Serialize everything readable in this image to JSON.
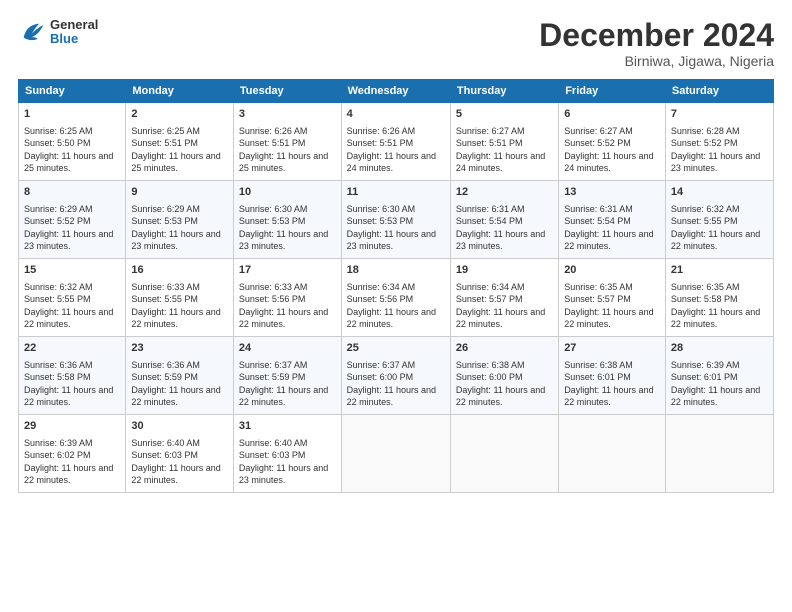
{
  "logo": {
    "general": "General",
    "blue": "Blue"
  },
  "header": {
    "title": "December 2024",
    "location": "Birniwa, Jigawa, Nigeria"
  },
  "weekdays": [
    "Sunday",
    "Monday",
    "Tuesday",
    "Wednesday",
    "Thursday",
    "Friday",
    "Saturday"
  ],
  "weeks": [
    [
      {
        "day": "1",
        "info": "Sunrise: 6:25 AM\nSunset: 5:50 PM\nDaylight: 11 hours and 25 minutes."
      },
      {
        "day": "2",
        "info": "Sunrise: 6:25 AM\nSunset: 5:51 PM\nDaylight: 11 hours and 25 minutes."
      },
      {
        "day": "3",
        "info": "Sunrise: 6:26 AM\nSunset: 5:51 PM\nDaylight: 11 hours and 25 minutes."
      },
      {
        "day": "4",
        "info": "Sunrise: 6:26 AM\nSunset: 5:51 PM\nDaylight: 11 hours and 24 minutes."
      },
      {
        "day": "5",
        "info": "Sunrise: 6:27 AM\nSunset: 5:51 PM\nDaylight: 11 hours and 24 minutes."
      },
      {
        "day": "6",
        "info": "Sunrise: 6:27 AM\nSunset: 5:52 PM\nDaylight: 11 hours and 24 minutes."
      },
      {
        "day": "7",
        "info": "Sunrise: 6:28 AM\nSunset: 5:52 PM\nDaylight: 11 hours and 23 minutes."
      }
    ],
    [
      {
        "day": "8",
        "info": "Sunrise: 6:29 AM\nSunset: 5:52 PM\nDaylight: 11 hours and 23 minutes."
      },
      {
        "day": "9",
        "info": "Sunrise: 6:29 AM\nSunset: 5:53 PM\nDaylight: 11 hours and 23 minutes."
      },
      {
        "day": "10",
        "info": "Sunrise: 6:30 AM\nSunset: 5:53 PM\nDaylight: 11 hours and 23 minutes."
      },
      {
        "day": "11",
        "info": "Sunrise: 6:30 AM\nSunset: 5:53 PM\nDaylight: 11 hours and 23 minutes."
      },
      {
        "day": "12",
        "info": "Sunrise: 6:31 AM\nSunset: 5:54 PM\nDaylight: 11 hours and 23 minutes."
      },
      {
        "day": "13",
        "info": "Sunrise: 6:31 AM\nSunset: 5:54 PM\nDaylight: 11 hours and 22 minutes."
      },
      {
        "day": "14",
        "info": "Sunrise: 6:32 AM\nSunset: 5:55 PM\nDaylight: 11 hours and 22 minutes."
      }
    ],
    [
      {
        "day": "15",
        "info": "Sunrise: 6:32 AM\nSunset: 5:55 PM\nDaylight: 11 hours and 22 minutes."
      },
      {
        "day": "16",
        "info": "Sunrise: 6:33 AM\nSunset: 5:55 PM\nDaylight: 11 hours and 22 minutes."
      },
      {
        "day": "17",
        "info": "Sunrise: 6:33 AM\nSunset: 5:56 PM\nDaylight: 11 hours and 22 minutes."
      },
      {
        "day": "18",
        "info": "Sunrise: 6:34 AM\nSunset: 5:56 PM\nDaylight: 11 hours and 22 minutes."
      },
      {
        "day": "19",
        "info": "Sunrise: 6:34 AM\nSunset: 5:57 PM\nDaylight: 11 hours and 22 minutes."
      },
      {
        "day": "20",
        "info": "Sunrise: 6:35 AM\nSunset: 5:57 PM\nDaylight: 11 hours and 22 minutes."
      },
      {
        "day": "21",
        "info": "Sunrise: 6:35 AM\nSunset: 5:58 PM\nDaylight: 11 hours and 22 minutes."
      }
    ],
    [
      {
        "day": "22",
        "info": "Sunrise: 6:36 AM\nSunset: 5:58 PM\nDaylight: 11 hours and 22 minutes."
      },
      {
        "day": "23",
        "info": "Sunrise: 6:36 AM\nSunset: 5:59 PM\nDaylight: 11 hours and 22 minutes."
      },
      {
        "day": "24",
        "info": "Sunrise: 6:37 AM\nSunset: 5:59 PM\nDaylight: 11 hours and 22 minutes."
      },
      {
        "day": "25",
        "info": "Sunrise: 6:37 AM\nSunset: 6:00 PM\nDaylight: 11 hours and 22 minutes."
      },
      {
        "day": "26",
        "info": "Sunrise: 6:38 AM\nSunset: 6:00 PM\nDaylight: 11 hours and 22 minutes."
      },
      {
        "day": "27",
        "info": "Sunrise: 6:38 AM\nSunset: 6:01 PM\nDaylight: 11 hours and 22 minutes."
      },
      {
        "day": "28",
        "info": "Sunrise: 6:39 AM\nSunset: 6:01 PM\nDaylight: 11 hours and 22 minutes."
      }
    ],
    [
      {
        "day": "29",
        "info": "Sunrise: 6:39 AM\nSunset: 6:02 PM\nDaylight: 11 hours and 22 minutes."
      },
      {
        "day": "30",
        "info": "Sunrise: 6:40 AM\nSunset: 6:03 PM\nDaylight: 11 hours and 22 minutes."
      },
      {
        "day": "31",
        "info": "Sunrise: 6:40 AM\nSunset: 6:03 PM\nDaylight: 11 hours and 23 minutes."
      },
      {
        "day": "",
        "info": ""
      },
      {
        "day": "",
        "info": ""
      },
      {
        "day": "",
        "info": ""
      },
      {
        "day": "",
        "info": ""
      }
    ]
  ]
}
